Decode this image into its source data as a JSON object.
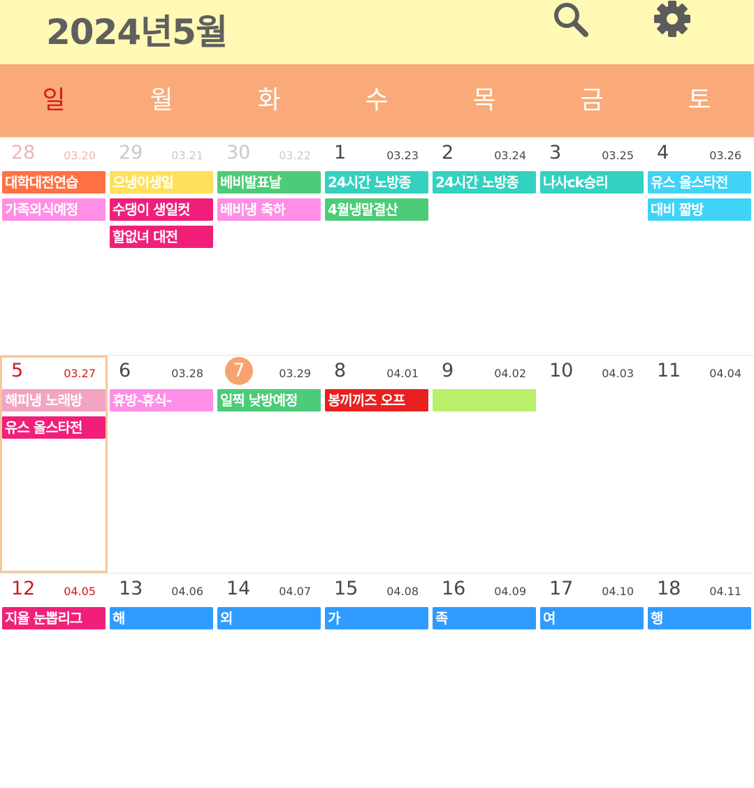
{
  "header": {
    "title": "2024년5월",
    "search_icon": "search-icon",
    "settings_icon": "gear-icon"
  },
  "colors": {
    "header_bg": "#fff9b5",
    "weekday_bg": "#f9aa78",
    "sunday": "#d21919",
    "today": "#f6a370",
    "selected_border": "#f5c89a"
  },
  "weekdays": [
    "일",
    "월",
    "화",
    "수",
    "목",
    "금",
    "토"
  ],
  "weeks": [
    {
      "days": [
        {
          "day": "28",
          "lunar": "03.20",
          "events": [
            {
              "title": "대학대전연습",
              "color": "#ff7043"
            },
            {
              "title": "가족외식예정",
              "color": "#ff8ee6"
            }
          ]
        },
        {
          "day": "29",
          "lunar": "03.21",
          "events": [
            {
              "title": "으냉이생일",
              "color": "#ffe05a"
            },
            {
              "title": "수댕이 생일컷",
              "color": "#f0207a"
            },
            {
              "title": "할없녀 대전",
              "color": "#f0207a"
            }
          ]
        },
        {
          "day": "30",
          "lunar": "03.22",
          "events": [
            {
              "title": "베비발표날",
              "color": "#4ccb78"
            },
            {
              "title": "베비냉 축하",
              "color": "#ff8ee6"
            }
          ]
        },
        {
          "day": "1",
          "lunar": "03.23",
          "events": [
            {
              "title": "24시간 노방종",
              "color": "#33d1c0"
            },
            {
              "title": "4월냉말결산",
              "color": "#4ccb78"
            }
          ]
        },
        {
          "day": "2",
          "lunar": "03.24",
          "events": [
            {
              "title": "24시간 노방종",
              "color": "#33d1c0"
            }
          ]
        },
        {
          "day": "3",
          "lunar": "03.25",
          "events": [
            {
              "title": "나사ck승리",
              "color": "#33d1c0"
            }
          ]
        },
        {
          "day": "4",
          "lunar": "03.26",
          "events": [
            {
              "title": "유스 올스타전",
              "color": "#40d3f5"
            },
            {
              "title": "대비 짧방",
              "color": "#40d3f5"
            }
          ]
        }
      ]
    },
    {
      "days": [
        {
          "day": "5",
          "lunar": "03.27",
          "events": [
            {
              "title": "해피냉 노래방",
              "color": "#f2a4c2"
            },
            {
              "title": "유스 올스타전",
              "color": "#f0207a"
            }
          ]
        },
        {
          "day": "6",
          "lunar": "03.28",
          "events": [
            {
              "title": "휴방-휴식-",
              "color": "#ff8ee6"
            }
          ]
        },
        {
          "day": "7",
          "lunar": "03.29",
          "events": [
            {
              "title": "일찍 낮방예정",
              "color": "#4ccb78"
            }
          ]
        },
        {
          "day": "8",
          "lunar": "04.01",
          "events": [
            {
              "title": "봉끼끼즈 오프",
              "color": "#e82020"
            }
          ]
        },
        {
          "day": "9",
          "lunar": "04.02",
          "events": [
            {
              "title": "",
              "color": "#b8f06b"
            }
          ]
        },
        {
          "day": "10",
          "lunar": "04.03",
          "events": []
        },
        {
          "day": "11",
          "lunar": "04.04",
          "events": []
        }
      ]
    },
    {
      "days": [
        {
          "day": "12",
          "lunar": "04.05",
          "events": [
            {
              "title": "지율 눈뽑리그",
              "color": "#f0207a"
            }
          ]
        },
        {
          "day": "13",
          "lunar": "04.06",
          "events": [
            {
              "title": "해",
              "color": "#2f9bff"
            }
          ]
        },
        {
          "day": "14",
          "lunar": "04.07",
          "events": [
            {
              "title": "외",
              "color": "#2f9bff"
            }
          ]
        },
        {
          "day": "15",
          "lunar": "04.08",
          "events": [
            {
              "title": "가",
              "color": "#2f9bff"
            }
          ]
        },
        {
          "day": "16",
          "lunar": "04.09",
          "events": [
            {
              "title": "족",
              "color": "#2f9bff"
            }
          ]
        },
        {
          "day": "17",
          "lunar": "04.10",
          "events": [
            {
              "title": "여",
              "color": "#2f9bff"
            }
          ]
        },
        {
          "day": "18",
          "lunar": "04.11",
          "events": [
            {
              "title": "행",
              "color": "#2f9bff"
            }
          ]
        }
      ]
    }
  ]
}
